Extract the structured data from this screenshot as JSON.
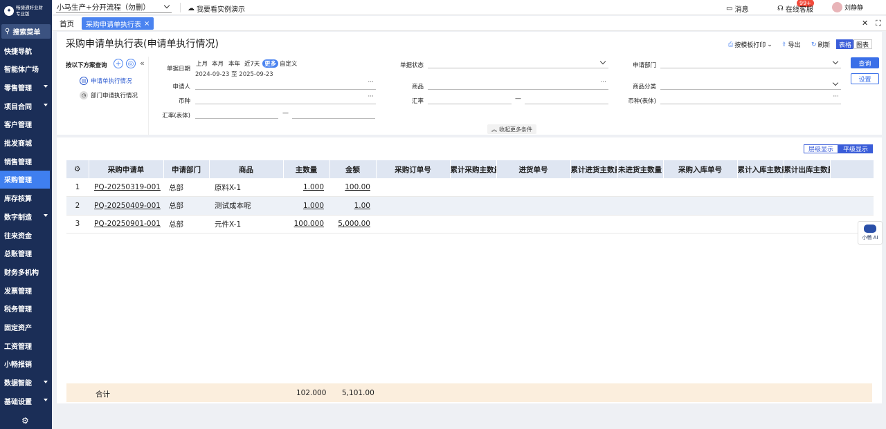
{
  "sidebar": {
    "brand": "畅捷通好业财",
    "edition": "专业版",
    "search_label": "搜索菜单",
    "items": [
      {
        "label": "快捷导航",
        "caret": false
      },
      {
        "label": "智能体广场",
        "caret": false
      },
      {
        "label": "零售管理",
        "caret": true
      },
      {
        "label": "项目合同",
        "caret": true
      },
      {
        "label": "客户管理",
        "caret": false
      },
      {
        "label": "批发商城",
        "caret": false
      },
      {
        "label": "销售管理",
        "caret": false
      },
      {
        "label": "采购管理",
        "caret": false,
        "active": true
      },
      {
        "label": "库存核算",
        "caret": false
      },
      {
        "label": "数字制造",
        "caret": true
      },
      {
        "label": "往来资金",
        "caret": false
      },
      {
        "label": "总账管理",
        "caret": false
      },
      {
        "label": "财务多机构",
        "caret": false
      },
      {
        "label": "发票管理",
        "caret": false
      },
      {
        "label": "税务管理",
        "caret": false
      },
      {
        "label": "固定资产",
        "caret": false
      },
      {
        "label": "工资管理",
        "caret": false
      },
      {
        "label": "小畅报销",
        "caret": false
      },
      {
        "label": "数据智能",
        "caret": true
      },
      {
        "label": "基础设置",
        "caret": true
      }
    ]
  },
  "topbar": {
    "account": "小马生产+分开流程（勿删）",
    "demo": "我要看实例演示",
    "messages": "消息",
    "badge": "99+",
    "service": "在线客服",
    "user": "刘静静"
  },
  "tabs": {
    "home": "首页",
    "active": "采购申请单执行表"
  },
  "header": {
    "title": "采购申请单执行表(申请单执行情况)",
    "print": "按模板打印",
    "export": "导出",
    "refresh": "刷新",
    "table": "表格",
    "chart": "图表"
  },
  "scheme": {
    "title": "按以下方案查询",
    "options": [
      "申请单执行情况",
      "部门申请执行情况"
    ]
  },
  "filters": {
    "date_label": "单据日期",
    "date_opts": [
      "上月",
      "本月",
      "本年",
      "近7天"
    ],
    "more": "更多",
    "custom": "自定义",
    "date_range": "2024-09-23 至 2025-09-23",
    "status": "单据状态",
    "dept": "申请部门",
    "applicant": "申请人",
    "product": "商品",
    "category": "商品分类",
    "currency": "币种",
    "rate": "汇率",
    "currency_body": "币种(表体)",
    "rate_body": "汇率(表体)",
    "query": "查询",
    "settings": "设置",
    "collapse": "收起更多条件"
  },
  "view": {
    "tree": "层级显示",
    "flat": "平级显示"
  },
  "table": {
    "headers": [
      "采购申请单",
      "申请部门",
      "商品",
      "主数量",
      "金额",
      "采购订单号",
      "累计采购主数量",
      "进货单号",
      "累计进货主数量",
      "未进货主数量",
      "采购入库单号",
      "累计入库主数量",
      "累计出库主数量"
    ],
    "rows": [
      {
        "no": "1",
        "doc": "PQ-20250319-001",
        "dept": "总部",
        "product": "原料X-1",
        "qty": "1.000",
        "amount": "100.00"
      },
      {
        "no": "2",
        "doc": "PQ-20250409-001",
        "dept": "总部",
        "product": "测试成本呢",
        "qty": "1.000",
        "amount": "1.00"
      },
      {
        "no": "3",
        "doc": "PQ-20250901-001",
        "dept": "总部",
        "product": "元件X-1",
        "qty": "100.000",
        "amount": "5,000.00"
      }
    ],
    "total_label": "合计",
    "total_qty": "102.000",
    "total_amount": "5,101.00"
  },
  "assistant": "小畅 AI"
}
